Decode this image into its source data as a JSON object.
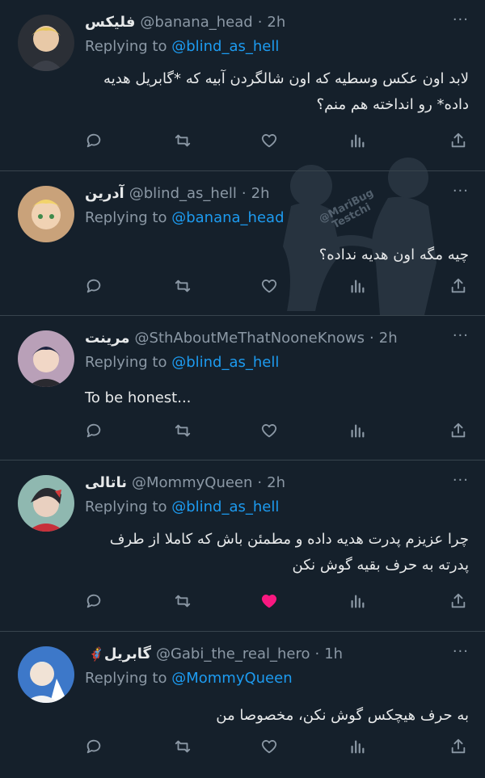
{
  "tweets": [
    {
      "display_name": "فلیکس",
      "handle": "@banana_head",
      "time": "2h",
      "replying_prefix": "Replying to",
      "replying_to": "@blind_as_hell",
      "text": "لابد اون عکس وسطیه که اون شالگردن آبیه که *گابریل هدیه داده* رو انداخته هم منم؟",
      "liked": false
    },
    {
      "display_name": "آدرین",
      "handle": "@blind_as_hell",
      "time": "2h",
      "replying_prefix": "Replying to",
      "replying_to": "@banana_head",
      "text": "چیه مگه اون هدیه نداده؟",
      "liked": false
    },
    {
      "display_name": "مرینت",
      "handle": "@SthAboutMeThatNooneKnows",
      "time": "2h",
      "replying_prefix": "Replying to",
      "replying_to": "@blind_as_hell",
      "text": "To be honest...",
      "liked": false
    },
    {
      "display_name": "ناتالی",
      "handle": "@MommyQueen",
      "time": "2h",
      "replying_prefix": "Replying to",
      "replying_to": "@blind_as_hell",
      "text": "چرا عزیزم پدرت هدیه داده و مطمئن باش که کاملا از طرف پدرته به حرف بقیه گوش نکن",
      "liked": true
    },
    {
      "display_name": "گابریل",
      "name_emoji": "🦸",
      "handle": "@Gabi_the_real_hero",
      "time": "1h",
      "replying_prefix": "Replying to",
      "replying_to": "@MommyQueen",
      "text": "به حرف هیچکس گوش نکن، مخصوصا من",
      "liked": false
    }
  ],
  "separator": "·",
  "more_glyph": "···",
  "watermark": {
    "line1": "@MariBug",
    "line2": "Testchi"
  },
  "colors": {
    "background": "#15202b",
    "divider": "#38444d",
    "secondary_text": "#8b98a5",
    "link": "#1d9bf0",
    "like_active": "#f91880"
  },
  "action_icons": [
    "reply-icon",
    "retweet-icon",
    "like-icon",
    "views-icon",
    "share-icon"
  ]
}
